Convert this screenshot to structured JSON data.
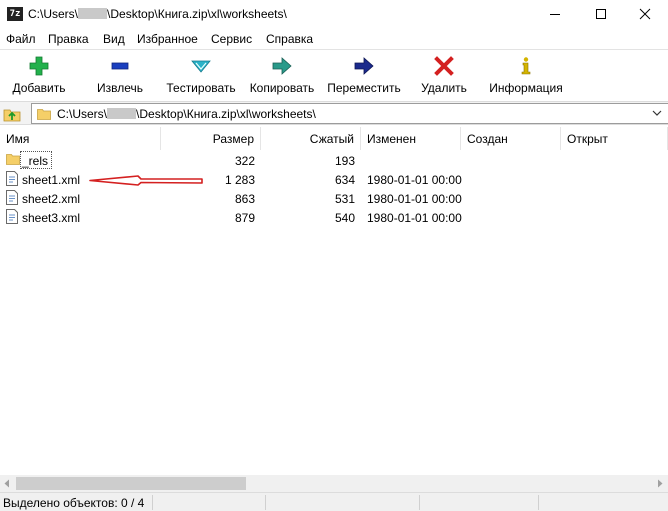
{
  "window": {
    "app_icon_text": "7z",
    "title_prefix": "C:\\Users\\",
    "title_suffix": "\\Desktop\\Книга.zip\\xl\\worksheets\\"
  },
  "menu": [
    "Файл",
    "Правка",
    "Вид",
    "Избранное",
    "Сервис",
    "Справка"
  ],
  "toolbar": [
    {
      "label": "Добавить",
      "icon": "plus-icon",
      "color": "#22b14c"
    },
    {
      "label": "Извлечь",
      "icon": "minus-icon",
      "color": "#1a3fbf"
    },
    {
      "label": "Тестировать",
      "icon": "check-icon",
      "color": "#2bb3c8"
    },
    {
      "label": "Копировать",
      "icon": "copy-arrow-icon",
      "color": "#2a9a8a"
    },
    {
      "label": "Переместить",
      "icon": "move-arrow-icon",
      "color": "#1b2a8c"
    },
    {
      "label": "Удалить",
      "icon": "delete-icon",
      "color": "#d42020"
    },
    {
      "label": "Информация",
      "icon": "info-icon",
      "color": "#d4b400"
    }
  ],
  "address": {
    "prefix": "C:\\Users\\",
    "suffix": "\\Desktop\\Книга.zip\\xl\\worksheets\\"
  },
  "columns": [
    "Имя",
    "Размер",
    "Сжатый",
    "Изменен",
    "Создан",
    "Открыт"
  ],
  "files": [
    {
      "name": "_rels",
      "type": "folder",
      "size": "322",
      "packed": "193",
      "modified": ""
    },
    {
      "name": "sheet1.xml",
      "type": "file",
      "size": "1 283",
      "packed": "634",
      "modified": "1980-01-01 00:00"
    },
    {
      "name": "sheet2.xml",
      "type": "file",
      "size": "863",
      "packed": "531",
      "modified": "1980-01-01 00:00"
    },
    {
      "name": "sheet3.xml",
      "type": "file",
      "size": "879",
      "packed": "540",
      "modified": "1980-01-01 00:00"
    }
  ],
  "status": {
    "selected": "Выделено объектов: 0 / 4"
  },
  "colors": {
    "annotation_arrow": "#d42020",
    "folder": "#f5cf68"
  }
}
